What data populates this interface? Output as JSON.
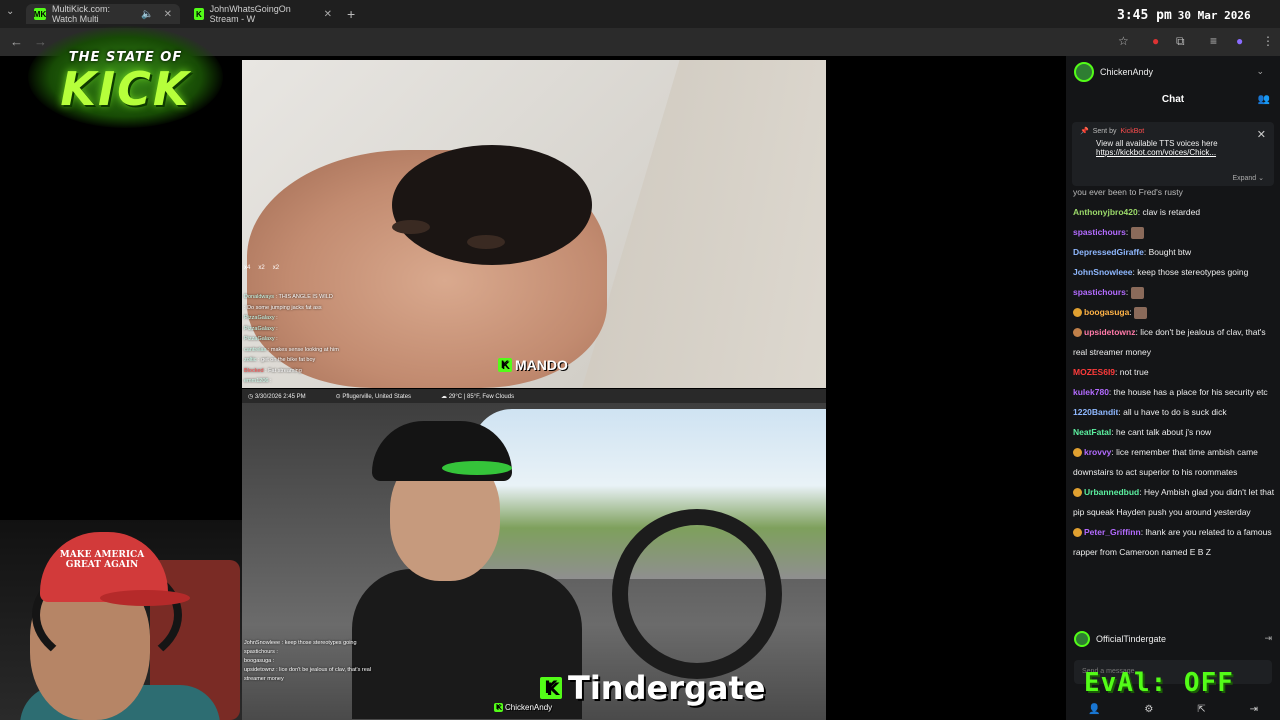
{
  "browser": {
    "tabs": [
      {
        "label": "MultiKick.com: Watch Multi",
        "favicon": "MK"
      },
      {
        "label": "JohnWhatsGoingOn Stream - W",
        "favicon": "K"
      }
    ],
    "clock": {
      "time": "3:45 pm",
      "date": "30 Mar 2026"
    }
  },
  "logo": {
    "line1": "THE STATE OF",
    "line2": "KICK"
  },
  "top_stream": {
    "emote_counts": [
      "x4",
      "x2",
      "x2"
    ],
    "overlay_chat": [
      {
        "user": "Donaldways",
        "text": "THIS ANGLE IS WILD"
      },
      {
        "user": "",
        "text": "Do some jumping jacks fat ass"
      },
      {
        "user": "PizzaGalaxy",
        "text": ""
      },
      {
        "user": "PizzaGalaxy",
        "text": ""
      },
      {
        "user": "PizzaGalaxy",
        "text": ""
      },
      {
        "user": "cantrelax",
        "text": "makes sense looking at him"
      },
      {
        "user": "zoltic",
        "text": "get on the bike fat boy"
      },
      {
        "user": "Blocked",
        "text": "Fat streaming"
      },
      {
        "user": "emm1206",
        "text": ""
      }
    ],
    "streamer_tag": "MANDO"
  },
  "bottom_stream": {
    "info": {
      "datetime": "3/30/2026 2:45 PM",
      "location": "Pflugerville, United States",
      "weather": "29°C | 85°F, Few Clouds"
    },
    "mini_chat": [
      {
        "user": "JohnSnowleee",
        "text": "keep those stereotypes going"
      },
      {
        "user": "spastichours",
        "text": ""
      },
      {
        "user": "boogasuga",
        "text": ""
      },
      {
        "user": "upsidetownz",
        "text": "lice don't be jealous of clav, that's real streamer money"
      }
    ],
    "title": "Tindergate",
    "channel_tag": "ChickenAndy"
  },
  "webcam": {
    "hat_text": "MAKE AMERICA GREAT AGAIN"
  },
  "chat": {
    "channel": "ChickenAndy",
    "title": "Chat",
    "pinned": {
      "sent_by": "Sent by",
      "bot": "KickBot",
      "message": "View all available TTS voices here",
      "link": "https://kickbot.com/voices/Chick...",
      "expand": "Expand"
    },
    "messages": [
      {
        "user": "",
        "color": "#eeeeee",
        "text": "you ever been to Fred's rusty",
        "emote": false,
        "badge": ""
      },
      {
        "user": "Anthonyjbro420",
        "color": "#9bd96a",
        "text": "clav is retarded",
        "emote": false,
        "badge": ""
      },
      {
        "user": "spastichours",
        "color": "#b36bff",
        "text": "",
        "emote": true,
        "badge": ""
      },
      {
        "user": "DepressedGiraffe",
        "color": "#8fb8ff",
        "text": "Bought btw",
        "emote": false,
        "badge": ""
      },
      {
        "user": "JohnSnowleee",
        "color": "#8fb8ff",
        "text": "keep those stereotypes going",
        "emote": false,
        "badge": ""
      },
      {
        "user": "spastichours",
        "color": "#b36bff",
        "text": "",
        "emote": true,
        "badge": ""
      },
      {
        "user": "boogasuga",
        "color": "#ffb347",
        "text": "",
        "emote": true,
        "badge": "#e0a030"
      },
      {
        "user": "upsidetownz",
        "color": "#ff7aa8",
        "text": "lice don't be jealous of clav, that's real streamer money",
        "emote": false,
        "badge": "#c0804a"
      },
      {
        "user": "MOZES6I9",
        "color": "#ff3b3b",
        "text": "not true",
        "emote": false,
        "badge": ""
      },
      {
        "user": "kulek780",
        "color": "#b36bff",
        "text": "the house has a place for his security etc",
        "emote": false,
        "badge": ""
      },
      {
        "user": "1220Bandit",
        "color": "#8fb8ff",
        "text": "all u have to do is suck dick",
        "emote": false,
        "badge": ""
      },
      {
        "user": "NeatFatal",
        "color": "#5cf0a0",
        "text": "he cant talk about j's now",
        "emote": false,
        "badge": ""
      },
      {
        "user": "krovvy",
        "color": "#b36bff",
        "text": "lice remember that time ambish came downstairs to act superior to his roommates",
        "emote": false,
        "badge": "#e0a030"
      },
      {
        "user": "Urbannedbud",
        "color": "#5cf0a0",
        "text": "Hey Ambish glad you didn't let that pip squeak Hayden push you around yesterday",
        "emote": false,
        "badge": "#e0a030"
      },
      {
        "user": "Peter_Griffinn",
        "color": "#b36bff",
        "text": "lhank are you related to a famous rapper from Cameroon named E B Z",
        "emote": false,
        "badge": "#e0a030"
      }
    ],
    "footer_user": "OfficialTindergate",
    "input_placeholder": "Send a message",
    "overlay_status": "EvAl: OFF"
  },
  "colors": {
    "kick_green": "#53fc18",
    "chat_bg": "#141517"
  }
}
